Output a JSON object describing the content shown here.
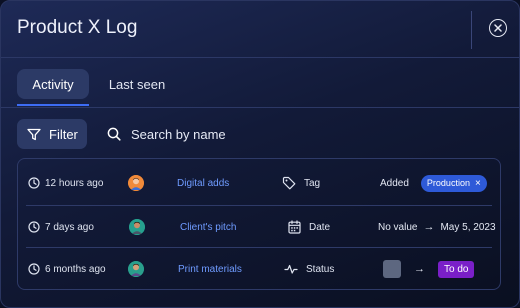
{
  "window": {
    "title": "Product X Log"
  },
  "tabs": [
    {
      "label": "Activity",
      "active": true
    },
    {
      "label": "Last seen",
      "active": false
    }
  ],
  "toolbar": {
    "filter_label": "Filter",
    "search_placeholder": "Search by name"
  },
  "colors": {
    "accent": "#3d6cf4",
    "link": "#6f9bff",
    "chip": "#2e5ad8",
    "status_todo": "#7a1fc8"
  },
  "activity": [
    {
      "time": "12 hours ago",
      "avatar_icon": "user-avatar",
      "item": "Digital adds",
      "field_icon": "tag-icon",
      "field": "Tag",
      "change_prefix": "Added",
      "chip": "Production"
    },
    {
      "time": "7 days ago",
      "avatar_icon": "user-avatar",
      "item": "Client's pitch",
      "field_icon": "calendar-icon",
      "field": "Date",
      "old_value": "No value",
      "new_value": "May 5, 2023"
    },
    {
      "time": "6 months ago",
      "avatar_icon": "user-avatar",
      "item": "Print materials",
      "field_icon": "activity-icon",
      "field": "Status",
      "new_value": "To do"
    }
  ]
}
